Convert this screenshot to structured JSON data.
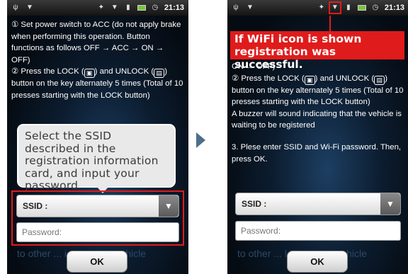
{
  "left": {
    "status": {
      "time": "21:13"
    },
    "instructions": {
      "step1": "① Set power switch to ACC (do not apply brake when performing this operation. Button functions as follows OFF → ACC → ON → OFF)",
      "step2_a": "② Press the LOCK (",
      "step2_b": ") and UNLOCK (",
      "step2_c": ") button on the key alternately 5 times (Total of 10 presses starting with the LOCK button)"
    },
    "callout": "Select the SSID described in the registration information card, and input your password.",
    "ssid_label": "SSID :",
    "password_placeholder": "Password:",
    "faded_text": "to other ... ic commu...vehicle",
    "ok_label": "OK"
  },
  "right": {
    "status": {
      "time": "21:13"
    },
    "banner": "If WiFi icon is shown registration was successful.",
    "instructions": {
      "line_on_off": "ON → OFF)",
      "step2_a": "② Press the LOCK (",
      "step2_b": ") and UNLOCK (",
      "step2_c": ") button on the key alternately 5 times (Total of 10 presses starting with the LOCK button)",
      "buzzer": "A buzzer will sound indicating that the vehicle is waiting to be registered",
      "step3": "3. Plese enter SSID and Wi-Fi password. Then, press OK."
    },
    "ssid_label": "SSID :",
    "password_placeholder": "Password:",
    "faded_text": "to other ... le commu...vehicle",
    "ok_label": "OK"
  },
  "icons": {
    "usb": "usb-icon",
    "download": "download-icon",
    "wifi": "wifi-icon",
    "signal": "signal-icon",
    "battery": "battery-icon",
    "clock": "clock-icon",
    "lock": "lock-key-icon",
    "unlock": "unlock-key-icon",
    "dropdown": "chevron-down-icon",
    "next": "arrow-right-icon"
  },
  "colors": {
    "highlight": "#e01b1b",
    "callout_bg": "#e9e9e9"
  }
}
